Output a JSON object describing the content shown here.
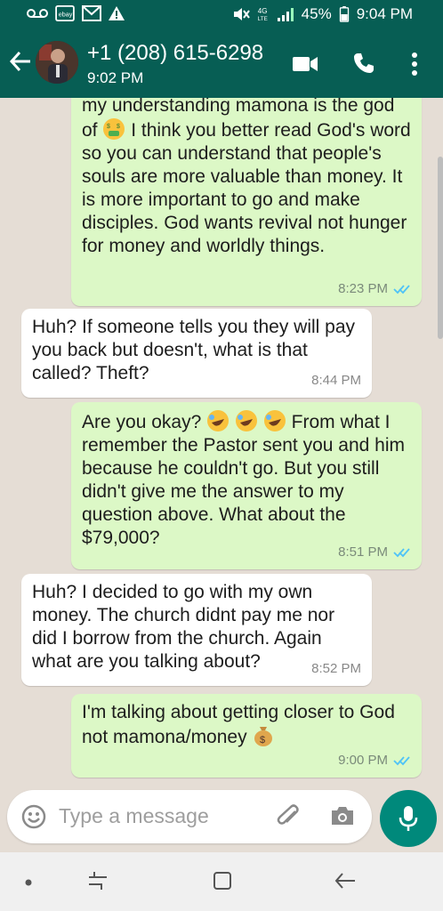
{
  "status_bar": {
    "battery": "45%",
    "time": "9:04 PM",
    "left_icons": [
      "voicemail-icon",
      "ebay-icon",
      "gmail-icon",
      "warning-icon"
    ],
    "right_icons": [
      "mute-icon",
      "4g-lte-icon",
      "signal-icon",
      "battery-icon"
    ]
  },
  "header": {
    "contact": "+1 (208) 615-6298",
    "last_seen": "9:02 PM",
    "icons": [
      "back-arrow-icon",
      "video-call-icon",
      "phone-icon",
      "more-icon"
    ]
  },
  "messages": [
    {
      "direction": "out",
      "parts": [
        "my understanding mamona is the god of",
        "money-mouth-face-emoji",
        " I think you better read God's word so you can understand that people's souls are more valuable than money. It is more important to go and make disciples. God wants revival not hunger for money and worldly things."
      ],
      "time": "8:23 PM",
      "status": "read"
    },
    {
      "direction": "in",
      "text": "Huh? If someone tells you they will pay you back but doesn't, what is that called? Theft?",
      "time": "8:44 PM"
    },
    {
      "direction": "out",
      "parts": [
        "Are you okay?",
        "rolling-on-floor-laughing-emoji",
        "rolling-on-floor-laughing-emoji",
        "rolling-on-floor-laughing-emoji",
        " From what I remember the Pastor sent you and him because he couldn't go. But you still didn't give me the answer to my question above. What about the $79,000?"
      ],
      "time": "8:51 PM",
      "status": "read"
    },
    {
      "direction": "in",
      "text": "Huh? I decided to go with my own money. The church didnt pay me nor did I borrow from the church. Again what are you talking about?",
      "time": "8:52 PM"
    },
    {
      "direction": "out",
      "parts": [
        "I'm talking about getting closer to God not mamona/money",
        "money-bag-emoji"
      ],
      "time": "9:00 PM",
      "status": "read"
    }
  ],
  "composer": {
    "placeholder": "Type a message",
    "icons": [
      "emoji-icon",
      "attach-icon",
      "camera-icon",
      "mic-icon"
    ]
  },
  "colors": {
    "header": "#075e54",
    "outgoing_bubble": "#dcf8c6",
    "incoming_bubble": "#ffffff",
    "read_tick": "#4fc3f7",
    "mic_button": "#00897b"
  }
}
